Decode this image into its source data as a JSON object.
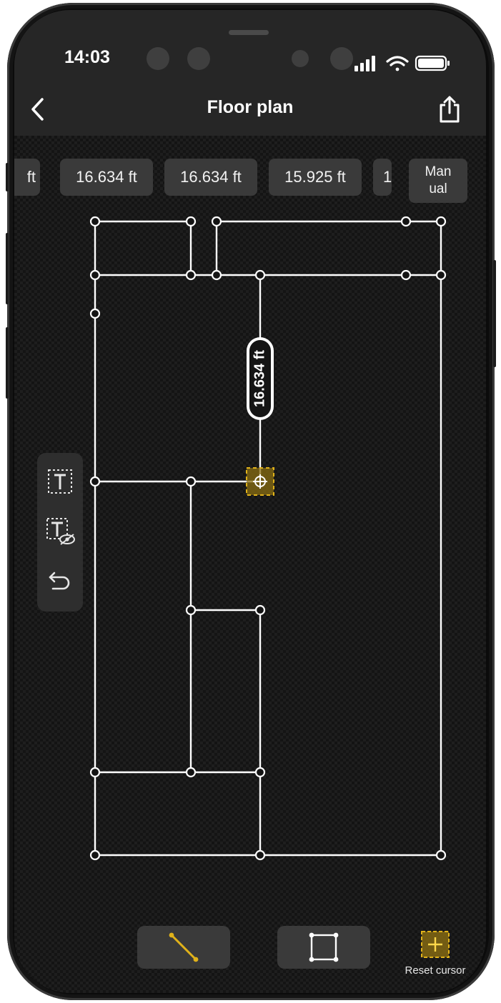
{
  "status_bar": {
    "time": "14:03"
  },
  "header": {
    "title": "Floor plan"
  },
  "measurements": {
    "partial_left": "ft",
    "items": [
      "16.634 ft",
      "16.634 ft",
      "15.925 ft"
    ],
    "partial_right": "1",
    "manual_line1": "Man",
    "manual_line2": "ual"
  },
  "plan": {
    "selected_dimension": "16.634 ft"
  },
  "left_tools": {
    "icons": [
      "text-label-icon",
      "text-visibility-icon",
      "undo-icon"
    ]
  },
  "bottom_tools": {
    "icons": [
      "draw-line-icon",
      "draw-rectangle-icon",
      "reset-cursor-icon"
    ],
    "reset_label": "Reset cursor"
  },
  "colors": {
    "accent": "#e0b21a",
    "line": "#ffffff",
    "background": "#141414",
    "panel": "#3a3a3a"
  }
}
